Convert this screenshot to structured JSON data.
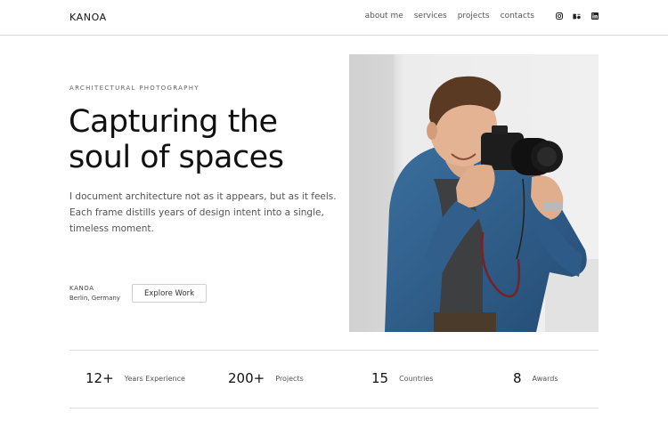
{
  "header": {
    "brand": "KANOA",
    "nav": [
      {
        "label": "about me"
      },
      {
        "label": "services"
      },
      {
        "label": "projects"
      },
      {
        "label": "contacts"
      }
    ],
    "social_icons": [
      "instagram-icon",
      "behance-icon",
      "linkedin-icon"
    ]
  },
  "hero": {
    "eyebrow": "ARCHITECTURAL PHOTOGRAPHY",
    "headline_line1": "Capturing the",
    "headline_line2": "soul of spaces",
    "lede_line1": "I document architecture not as it appears, but as it feels.",
    "lede_line2": "Each frame distills years of design intent into a single,",
    "lede_line3": "timeless moment.",
    "signature_name": "KANOA",
    "signature_location": "Berlin, Germany",
    "cta_label": "Explore Work"
  },
  "stats": [
    {
      "value": "12+",
      "label": "Years Experience"
    },
    {
      "value": "200+",
      "label": "Projects"
    },
    {
      "value": "15",
      "label": "Countries"
    },
    {
      "value": "8",
      "label": "Awards"
    }
  ],
  "colors": {
    "text": "#111111",
    "muted": "#555555",
    "rule": "#dcdcdc",
    "denim": "#2f5f8f"
  }
}
